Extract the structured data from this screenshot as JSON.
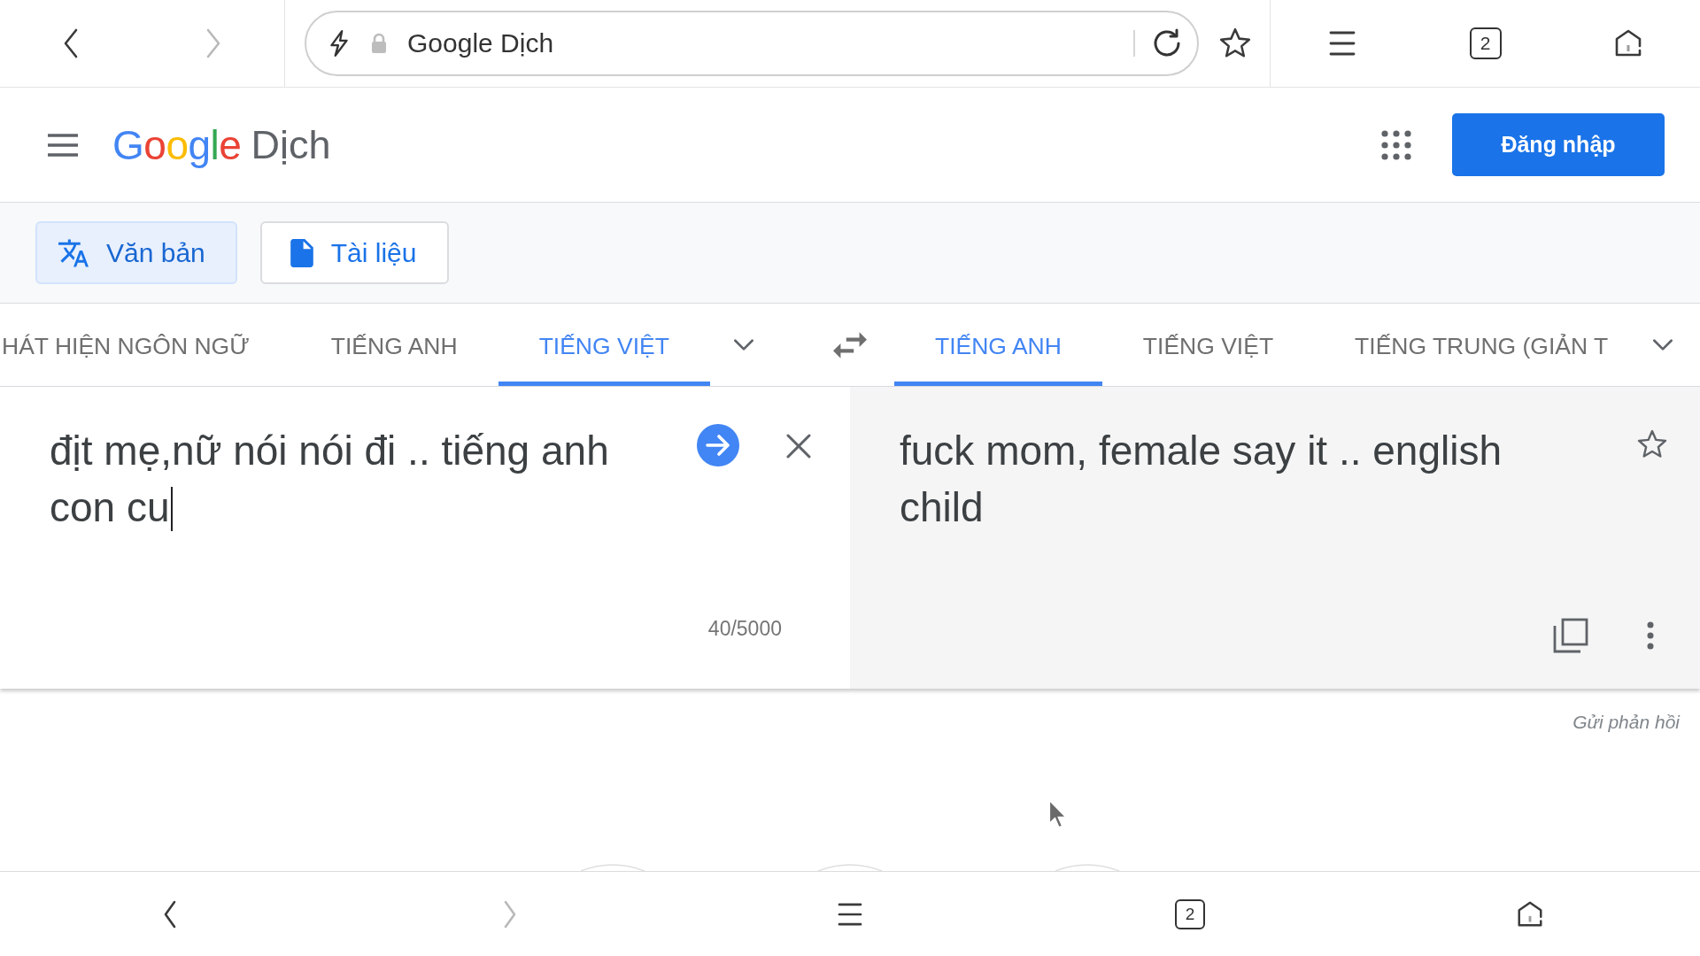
{
  "browser_toolbar": {
    "back": {
      "disabled": false
    },
    "forward": {
      "disabled": true
    },
    "address": "Google Dịch",
    "tab_count": "2"
  },
  "header": {
    "logo": "Google",
    "product": "Dịch",
    "sign_in": "Đăng nhập"
  },
  "mode_buttons": [
    {
      "kind": "text",
      "label": "Văn bản",
      "selected": true
    },
    {
      "kind": "document",
      "label": "Tài liệu",
      "selected": false
    }
  ],
  "source_languages": [
    {
      "label": "HÁT HIỆN NGÔN NGỮ",
      "selected": false
    },
    {
      "label": "TIẾNG ANH",
      "selected": false
    },
    {
      "label": "TIẾNG VIỆT",
      "selected": true
    }
  ],
  "target_languages": [
    {
      "label": "TIẾNG ANH",
      "selected": true
    },
    {
      "label": "TIẾNG VIỆT",
      "selected": false
    },
    {
      "label": "TIẾNG TRUNG (GIẢN T",
      "selected": false
    }
  ],
  "source": {
    "text": "địt mẹ,nữ nói nói đi .. tiếng anh con cu",
    "char_count": "40/5000"
  },
  "translation": {
    "text": "fuck mom, female say it .. english child"
  },
  "feedback": "Gửi phản hồi",
  "bottom_bar": {
    "back": {
      "disabled": false
    },
    "forward": {
      "disabled": true
    },
    "tab_count": "2"
  }
}
